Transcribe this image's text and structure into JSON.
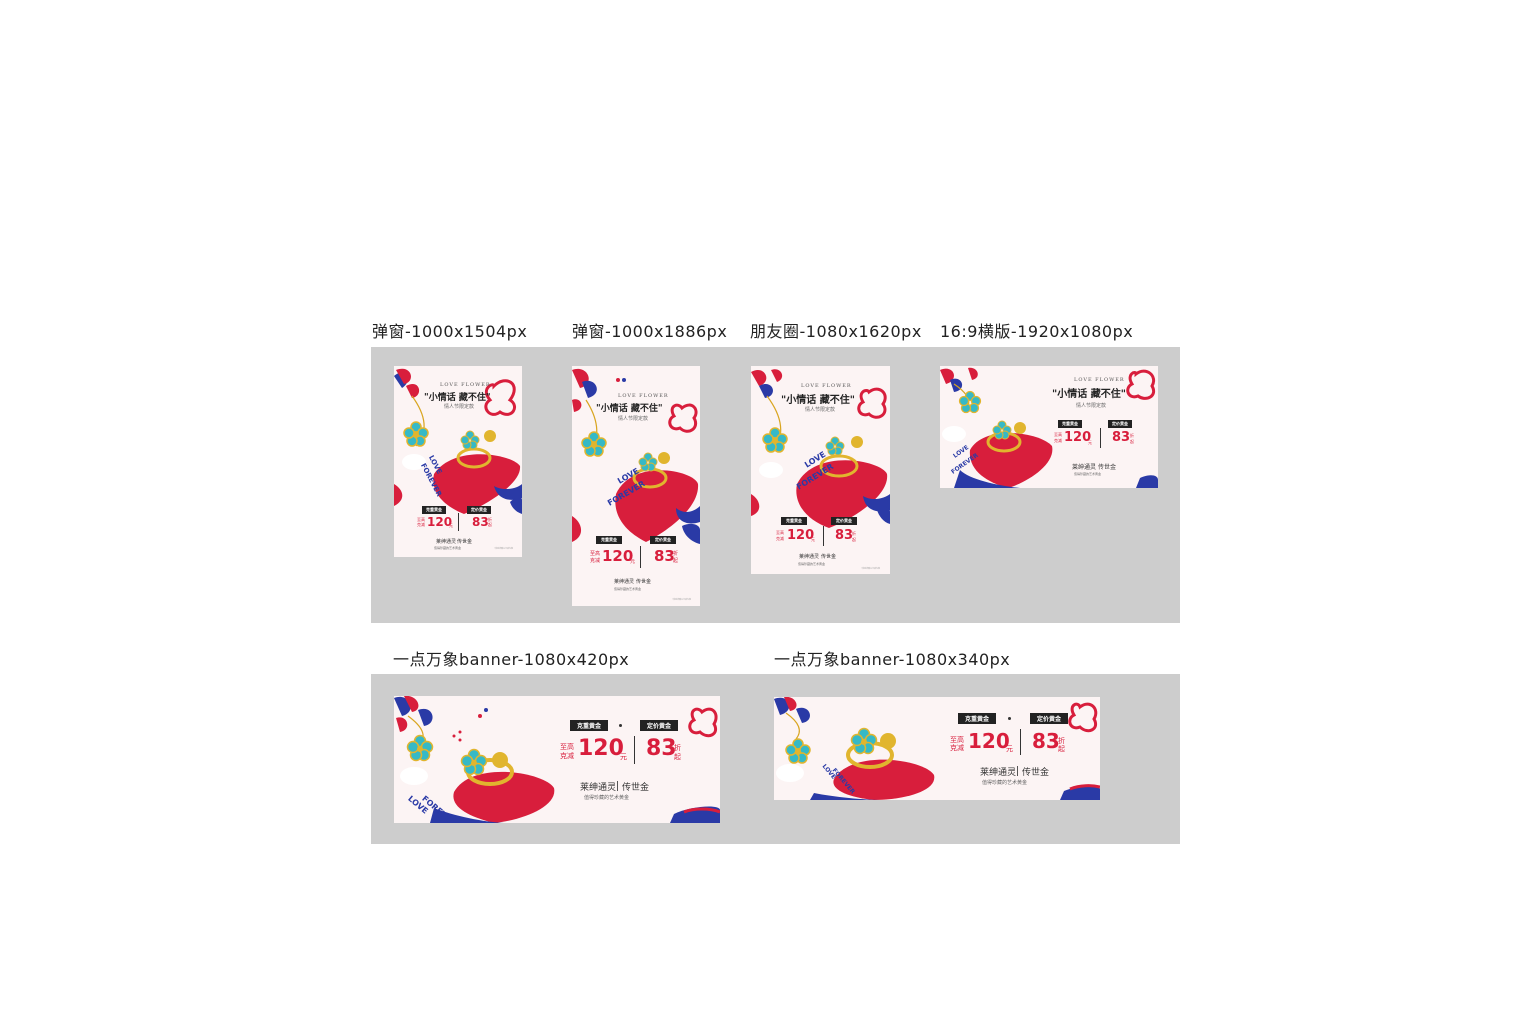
{
  "labels": {
    "popup_1504": "弹窗-1000x1504px",
    "popup_1886": "弹窗-1000x1886px",
    "moments": "朋友圈-1080x1620px",
    "landscape": "16:9横版-1920x1080px",
    "banner_420": "一点万象banner-1080x420px",
    "banner_340": "一点万象banner-1080x340px"
  },
  "ad": {
    "brand_en": "LOVE FLOWER",
    "headline": "\"小情话  藏不住\"",
    "subtitle": "情人节限定款",
    "tag_weight": "克重黄金",
    "tag_fixed": "定价黄金",
    "up_to": "至高",
    "per_gram": "克减",
    "discount_value": "120",
    "yuan": "元",
    "rate_value": "83",
    "zhe": "折",
    "qi": "起",
    "brand_cn": "莱绅通灵",
    "brand_cn2": "传世金",
    "slogan": "值得珍藏的艺术黄金",
    "love_text": "LOVE",
    "forever_text": "FOREVER",
    "fine_print": "*活动详情以门店为准"
  },
  "colors": {
    "panel": "#cdcdcd",
    "card_bg": "#fcf4f4",
    "accent_red": "#d81e3c",
    "accent_blue": "#2a3aa6",
    "turquoise": "#36b9c6",
    "gold": "#e1b52e"
  }
}
